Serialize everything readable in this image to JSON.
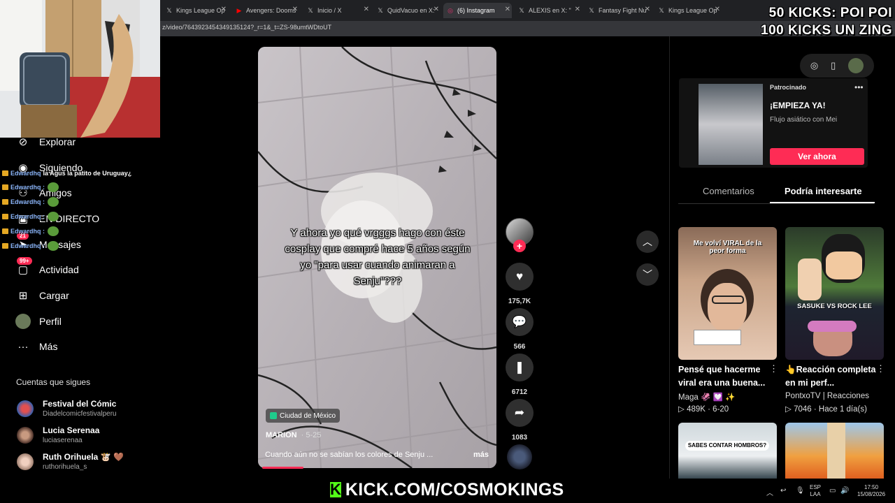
{
  "browser": {
    "tabs": [
      {
        "label": "Kings League Op",
        "icon": "x-icon"
      },
      {
        "label": "Avengers: Dooms",
        "icon": "youtube-icon"
      },
      {
        "label": "Inicio / X",
        "icon": "x-icon"
      },
      {
        "label": "QuidVacuo en X:",
        "icon": "x-icon"
      },
      {
        "label": "(6) Instagram",
        "icon": "instagram-icon"
      },
      {
        "label": "ALEXIS en X: \"",
        "icon": "x-icon"
      },
      {
        "label": "Fantasy Fight Nu",
        "icon": "x-icon"
      },
      {
        "label": "Kings League Op",
        "icon": "x-icon"
      }
    ],
    "url": "z/video/7643923454349135124?_r=1&_t=ZS-98umtWDtoUT"
  },
  "overlay": {
    "kicks_line1": "50 KICKS: POI POI",
    "kicks_line2": "100 KICKS UN ZING",
    "kick_url": "KICK.COM/COSMOKINGS",
    "kick_logo": "K"
  },
  "chat": [
    {
      "user": "Edwardhq",
      "msg": "la Agus la patito de Uruguay¿"
    },
    {
      "user": "Edwardhq :",
      "msg": ""
    },
    {
      "user": "Edwardhq :",
      "msg": ""
    },
    {
      "user": "Edwardhq :",
      "msg": ""
    },
    {
      "user": "Edwardhq :",
      "msg": ""
    },
    {
      "user": "Edwardhq :",
      "msg": ""
    }
  ],
  "sidebar": {
    "items": [
      {
        "label": "Explorar",
        "icon": "compass-icon"
      },
      {
        "label": "Siguiendo",
        "icon": "following-icon"
      },
      {
        "label": "Amigos",
        "icon": "friends-icon"
      },
      {
        "label": "EN DIRECTO",
        "icon": "live-icon"
      },
      {
        "label": "Mensajes",
        "icon": "messages-icon",
        "badge": "21"
      },
      {
        "label": "Actividad",
        "icon": "activity-icon",
        "badge": "99+"
      },
      {
        "label": "Cargar",
        "icon": "upload-icon"
      },
      {
        "label": "Perfil",
        "icon": "profile-icon"
      },
      {
        "label": "Más",
        "icon": "more-icon"
      }
    ],
    "following_title": "Cuentas que sigues",
    "following": [
      {
        "name": "Festival del Cómic",
        "handle": "Diadelcomicfestivalperu"
      },
      {
        "name": "Lucia Serenaa",
        "handle": "luciaserenaa"
      },
      {
        "name": "Ruth Orihuela 🐮 🤎",
        "handle": "ruthorihuela_s"
      }
    ]
  },
  "video": {
    "caption": "Y ahora yo qué vrgggs hago con éste cosplay que compré hace 5 años según yo \"para usar cuando animaran a Senju\"???",
    "location": "Ciudad de México",
    "author": "MARION",
    "date": "· 5-25",
    "description": "Cuando aún no se sabían los colores de Senju ...",
    "more": "más",
    "progress_fraction": 0.18
  },
  "actions": {
    "likes": "175,7K",
    "comments": "566",
    "saves": "6712",
    "shares": "1083"
  },
  "right_panel": {
    "ad": {
      "sponsored": "Patrocinado",
      "title": "¡EMPIEZA YA!",
      "subtitle": "Flujo asiático con Mei",
      "button": "Ver ahora"
    },
    "tabs": {
      "comments": "Comentarios",
      "recommended": "Podría interesarte"
    },
    "videos": [
      {
        "title": "Pensé que hacerme viral era una buena...",
        "author": "Maga 🦑 💟 ✨",
        "views": "489K",
        "date": "6-20",
        "thumb_text": "Me volví VIRAL de la peor forma"
      },
      {
        "title": "👆Reacción completa en mi perf...",
        "author": "PontxoTV | Reacciones",
        "views": "7046",
        "date": "Hace 1 día(s)",
        "thumb_text": "SASUKE VS ROCK LEE"
      },
      {
        "title": "",
        "author": "",
        "views": "",
        "date": "",
        "thumb_text": "SABES CONTAR HOMBROS?"
      },
      {
        "title": "",
        "author": "",
        "views": "",
        "date": "",
        "thumb_text": ""
      }
    ]
  },
  "taskbar": {
    "lang_line1": "ESP",
    "lang_line2": "LAA",
    "time": "17:50",
    "date": "15/08/2026"
  }
}
